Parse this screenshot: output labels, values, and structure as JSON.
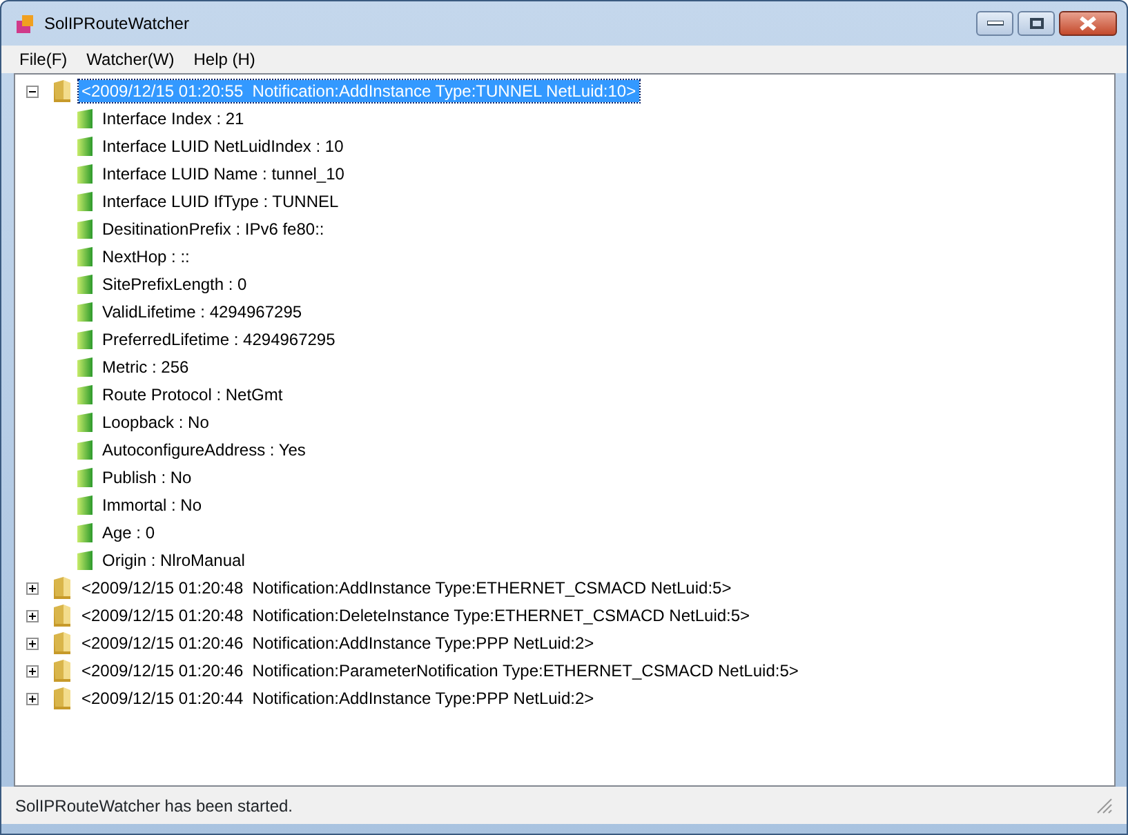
{
  "window": {
    "title": "SolIPRouteWatcher"
  },
  "menu": [
    "File(F)",
    "Watcher(W)",
    "Help (H)"
  ],
  "tree": [
    {
      "label": "<2009/12/15 01:20:55  Notification:AddInstance Type:TUNNEL NetLuid:10>",
      "expanded": true,
      "selected": true,
      "children": [
        {
          "label": "Interface Index : 21"
        },
        {
          "label": "Interface LUID NetLuidIndex : 10"
        },
        {
          "label": "Interface LUID Name : tunnel_10"
        },
        {
          "label": "Interface LUID IfType : TUNNEL"
        },
        {
          "label": "DesitinationPrefix : IPv6 fe80::"
        },
        {
          "label": "NextHop : ::"
        },
        {
          "label": "SitePrefixLength : 0"
        },
        {
          "label": "ValidLifetime : 4294967295"
        },
        {
          "label": "PreferredLifetime : 4294967295"
        },
        {
          "label": "Metric : 256"
        },
        {
          "label": "Route Protocol : NetGmt"
        },
        {
          "label": "Loopback : No"
        },
        {
          "label": "AutoconfigureAddress : Yes"
        },
        {
          "label": "Publish : No"
        },
        {
          "label": "Immortal : No"
        },
        {
          "label": "Age : 0"
        },
        {
          "label": "Origin : NlroManual"
        }
      ]
    },
    {
      "label": "<2009/12/15 01:20:48  Notification:AddInstance Type:ETHERNET_CSMACD NetLuid:5>",
      "expanded": false,
      "selected": false
    },
    {
      "label": "<2009/12/15 01:20:48  Notification:DeleteInstance Type:ETHERNET_CSMACD NetLuid:5>",
      "expanded": false,
      "selected": false
    },
    {
      "label": "<2009/12/15 01:20:46  Notification:AddInstance Type:PPP NetLuid:2>",
      "expanded": false,
      "selected": false
    },
    {
      "label": "<2009/12/15 01:20:46  Notification:ParameterNotification Type:ETHERNET_CSMACD NetLuid:5>",
      "expanded": false,
      "selected": false
    },
    {
      "label": "<2009/12/15 01:20:44  Notification:AddInstance Type:PPP NetLuid:2>",
      "expanded": false,
      "selected": false
    }
  ],
  "status_bar": "SolIPRouteWatcher has been started."
}
